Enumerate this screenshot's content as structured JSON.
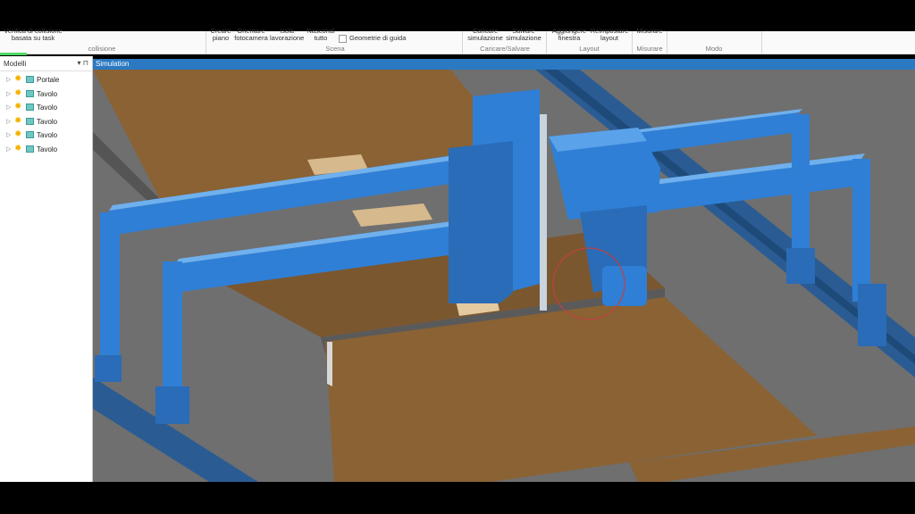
{
  "ribbon": {
    "collision_btn": "Verifica di collisione basata su task",
    "collision_group": "collisione",
    "scene": {
      "create_plane": "Creare piano",
      "orient_camera": "Orientare fotocamera",
      "isolate_work": "Isola lavorazione",
      "hide_all": "Nascondi tutto",
      "guide_geometry": "Geometrie di guida",
      "group": "Scena"
    },
    "load_save": {
      "load_sim": "Caricare simulazione",
      "save_sim": "Salvare simulazione",
      "group": "Caricare/Salvare"
    },
    "layout": {
      "add_window": "Aggiungere finestra",
      "reset_layout": "Reimpostare layout",
      "group": "Layout"
    },
    "measure": {
      "measure_btn": "Misurare",
      "group": "Misurare"
    },
    "mode": {
      "group": "Modo"
    }
  },
  "panel": {
    "title": "Modelli",
    "items": [
      {
        "label": "Portale"
      },
      {
        "label": "Tavolo"
      },
      {
        "label": "Tavolo"
      },
      {
        "label": "Tavolo"
      },
      {
        "label": "Tavolo"
      },
      {
        "label": "Tavolo"
      }
    ]
  },
  "simulation": {
    "title": "Simulation"
  },
  "colors": {
    "machine": "#2f7fd6",
    "table": "#8a6234",
    "floor": "#6f6f6f",
    "accent": "#2b79c2"
  }
}
